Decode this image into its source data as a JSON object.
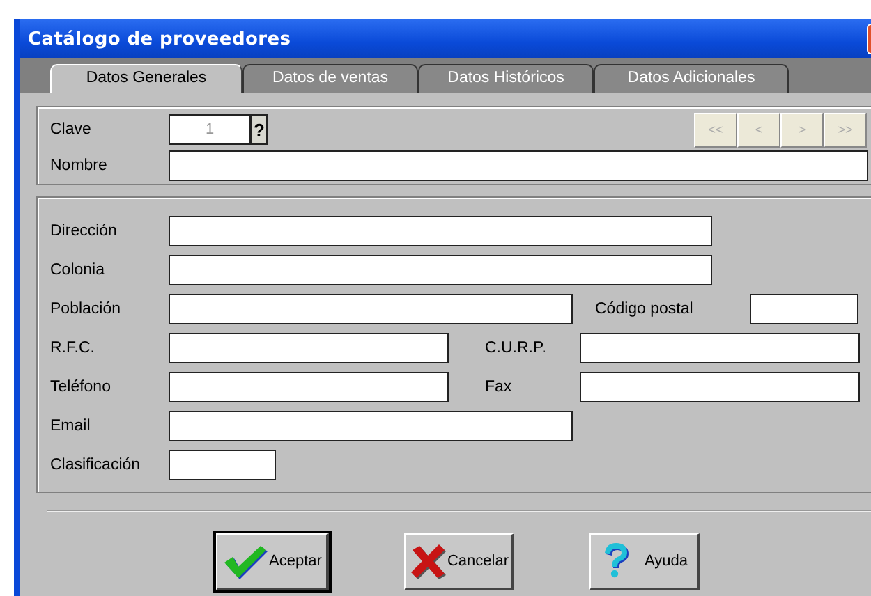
{
  "window": {
    "title": "Catálogo de proveedores"
  },
  "tabs": [
    {
      "label": "Datos Generales",
      "selected": true
    },
    {
      "label": "Datos de ventas",
      "selected": false
    },
    {
      "label": "Datos Históricos",
      "selected": false
    },
    {
      "label": "Datos Adicionales",
      "selected": false
    }
  ],
  "header": {
    "clave": {
      "label": "Clave",
      "value": "1",
      "disabled": true,
      "lookup": "?"
    },
    "navigation": [
      {
        "label": "<<",
        "disabled": true
      },
      {
        "label": "<",
        "disabled": true
      },
      {
        "label": ">",
        "disabled": true
      },
      {
        "label": ">>",
        "disabled": true
      }
    ],
    "nombre": {
      "label": "Nombre"
    }
  },
  "details": {
    "rows": [
      {
        "fields": [
          {
            "label": "Dirección"
          }
        ]
      },
      {
        "fields": [
          {
            "label": "Colonia"
          }
        ]
      },
      {
        "fields": [
          {
            "label": "Población"
          },
          {
            "label": "Código postal"
          }
        ]
      },
      {
        "fields": [
          {
            "label": "R.F.C."
          },
          {
            "label": "C.U.R.P."
          }
        ]
      },
      {
        "fields": [
          {
            "label": "Teléfono"
          },
          {
            "label": "Fax"
          }
        ]
      },
      {
        "fields": [
          {
            "label": "Email"
          }
        ]
      },
      {
        "fields": [
          {
            "label": "Clasificación"
          }
        ]
      }
    ]
  },
  "buttons": [
    {
      "label": "Aceptar",
      "kind": "check",
      "default": true
    },
    {
      "label": "Cancelar",
      "kind": "cross",
      "default": false
    },
    {
      "label": "Ayuda",
      "kind": "question",
      "default": false
    }
  ]
}
